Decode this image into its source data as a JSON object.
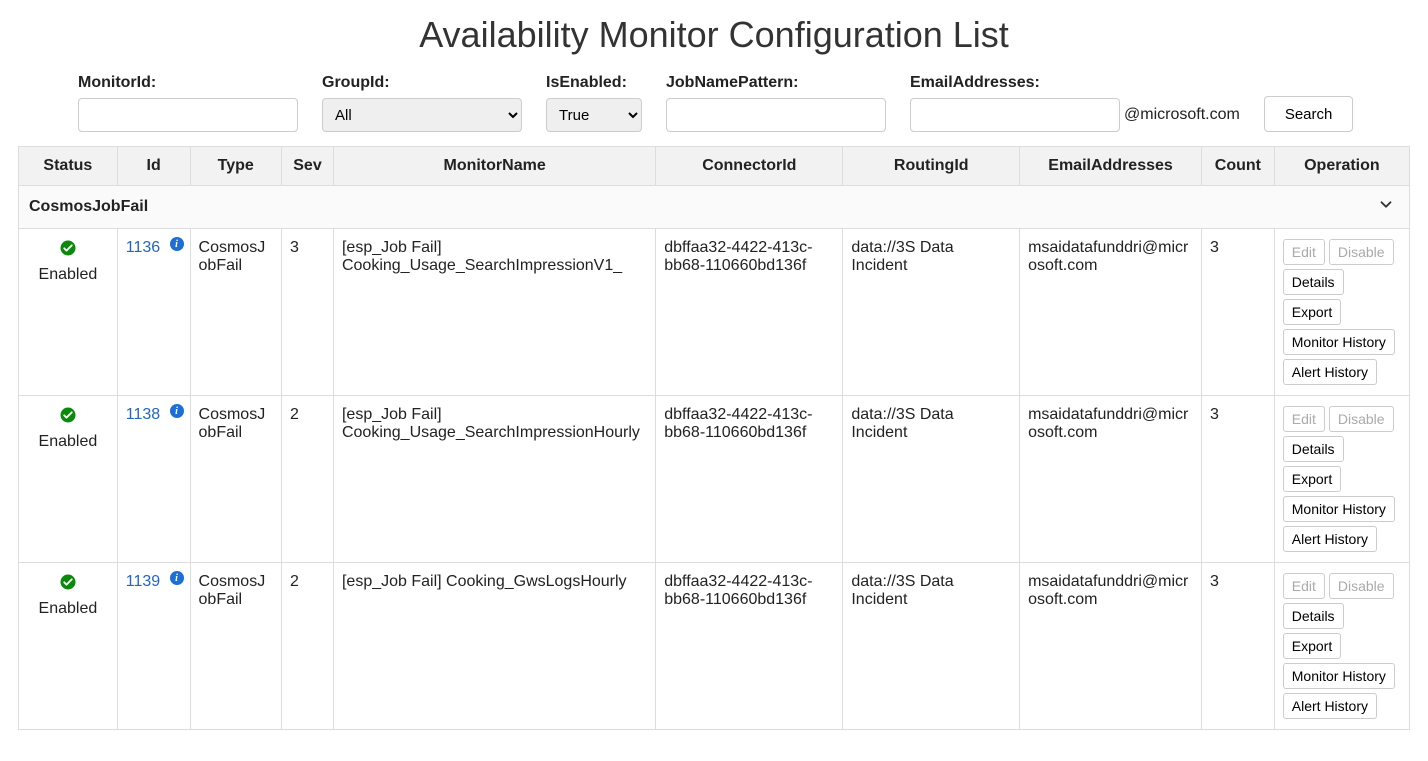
{
  "title": "Availability Monitor Configuration List",
  "filters": {
    "monitorId": {
      "label": "MonitorId:",
      "value": ""
    },
    "groupId": {
      "label": "GroupId:",
      "value": "All",
      "options": [
        "All"
      ]
    },
    "isEnabled": {
      "label": "IsEnabled:",
      "value": "True",
      "options": [
        "True"
      ]
    },
    "jobNamePattern": {
      "label": "JobNamePattern:",
      "value": ""
    },
    "emailAddresses": {
      "label": "EmailAddresses:",
      "value": "",
      "suffix": "@microsoft.com"
    },
    "searchLabel": "Search"
  },
  "columns": [
    "Status",
    "Id",
    "Type",
    "Sev",
    "MonitorName",
    "ConnectorId",
    "RoutingId",
    "EmailAddresses",
    "Count",
    "Operation"
  ],
  "groupName": "CosmosJobFail",
  "statusIconName": "check-circle-icon",
  "rows": [
    {
      "status": "Enabled",
      "id": "1136",
      "type": "CosmosJobFail",
      "sev": "3",
      "monitorName": "[esp_Job Fail] Cooking_Usage_SearchImpressionV1_",
      "connectorId": "dbffaa32-4422-413c-bb68-110660bd136f",
      "routingId": "data://3S Data Incident",
      "emailAddresses": "msaidatafunddri@microsoft.com",
      "count": "3"
    },
    {
      "status": "Enabled",
      "id": "1138",
      "type": "CosmosJobFail",
      "sev": "2",
      "monitorName": "[esp_Job Fail] Cooking_Usage_SearchImpressionHourly",
      "connectorId": "dbffaa32-4422-413c-bb68-110660bd136f",
      "routingId": "data://3S Data Incident",
      "emailAddresses": "msaidatafunddri@microsoft.com",
      "count": "3"
    },
    {
      "status": "Enabled",
      "id": "1139",
      "type": "CosmosJobFail",
      "sev": "2",
      "monitorName": "[esp_Job Fail] Cooking_GwsLogsHourly",
      "connectorId": "dbffaa32-4422-413c-bb68-110660bd136f",
      "routingId": "data://3S Data Incident",
      "emailAddresses": "msaidatafunddri@microsoft.com",
      "count": "3"
    }
  ],
  "operations": {
    "edit": "Edit",
    "disable": "Disable",
    "details": "Details",
    "export": "Export",
    "monitorHistory": "Monitor History",
    "alertHistory": "Alert History"
  }
}
